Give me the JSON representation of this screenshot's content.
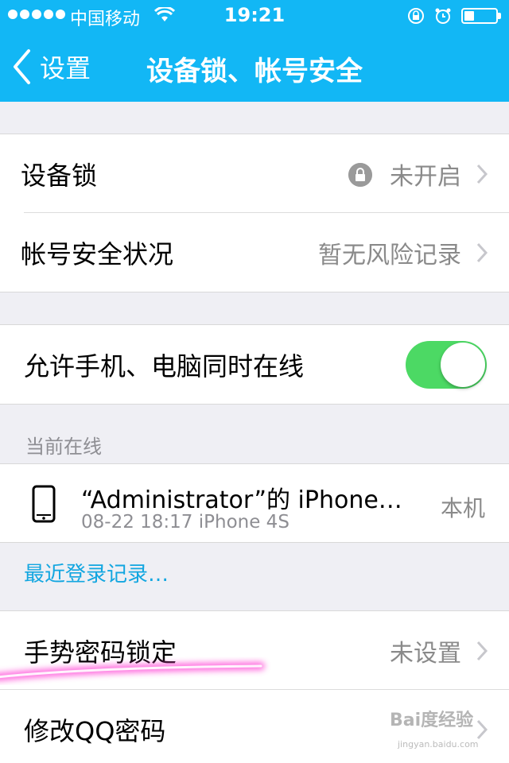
{
  "status_bar": {
    "carrier": "中国移动",
    "time": "19:21"
  },
  "nav": {
    "back_label": "设置",
    "title": "设备锁、帐号安全"
  },
  "security": {
    "device_lock_label": "设备锁",
    "device_lock_value": "未开启",
    "account_status_label": "帐号安全状况",
    "account_status_value": "暂无风险记录"
  },
  "online": {
    "allow_label": "允许手机、电脑同时在线",
    "allow_enabled": true,
    "section_header": "当前在线",
    "device_name": "“Administrator”的 iPhone…",
    "device_sub": "08-22 18:17  iPhone 4S",
    "device_tag": "本机",
    "recent_link": "最近登录记录…"
  },
  "more": {
    "gesture_label": "手势密码锁定",
    "gesture_value": "未设置",
    "change_pw_label": "修改QQ密码"
  },
  "watermark": {
    "text": "Bai度经验",
    "sub": "jingyan.baidu.com"
  },
  "colors": {
    "accent": "#12b7f5",
    "toggle_on": "#4cd964",
    "link": "#12a6e0"
  }
}
